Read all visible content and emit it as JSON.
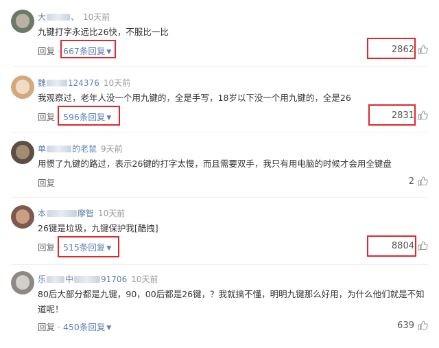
{
  "comments": [
    {
      "name_prefix": "大",
      "name_suffix": "、",
      "time": "10天前",
      "text": "九键打字永远比26快，不服比一比",
      "reply_label": "回复",
      "replies_label": "667条回复",
      "likes": "2862",
      "avatar_colors": [
        "#6b7a66",
        "#b9b1a3"
      ]
    },
    {
      "name_prefix": "魏",
      "name_suffix": "124376",
      "time": "10天前",
      "text": "我观察过，老年人没一个用九键的，全是手写，18岁以下没一个用九键的，全是26",
      "reply_label": "回复",
      "replies_label": "596条回复",
      "likes": "2831",
      "avatar_colors": [
        "#d4a97f",
        "#f1dcc3"
      ]
    },
    {
      "name_prefix": "单",
      "name_suffix": "的老鼠",
      "time": "9天前",
      "text": "用惯了九键的路过，表示26键的打字太慢，而且需要双手，我只有用电脑的时候才会用全键盘",
      "reply_label": "回复",
      "replies_label": "",
      "likes": "2",
      "avatar_colors": [
        "#5d4d42",
        "#a48c73"
      ]
    },
    {
      "name_prefix": "本",
      "name_suffix": "摩智",
      "time": "10天前",
      "text": "26键是垃圾，九键保护我[酷拽]",
      "reply_label": "回复",
      "replies_label": "515条回复",
      "likes": "8804",
      "avatar_colors": [
        "#7d5a4c",
        "#c99f86"
      ]
    },
    {
      "name_prefix": "乐",
      "name_middle": "中",
      "name_suffix": "91706",
      "time": "10天前",
      "text": "80后大部分都是九键，90，00后都是26键，？我就搞不懂，明明九键那么好用，为什么他们就是不知道呢！",
      "reply_label": "回复",
      "replies_label": "450条回复",
      "likes": "639",
      "avatar_colors": [
        "#8d8a86",
        "#d2cfcb"
      ]
    }
  ],
  "icons": {
    "like": "thumbs-up-icon",
    "expand": "chevron-down-icon"
  },
  "highlight_color": "#e0262b"
}
